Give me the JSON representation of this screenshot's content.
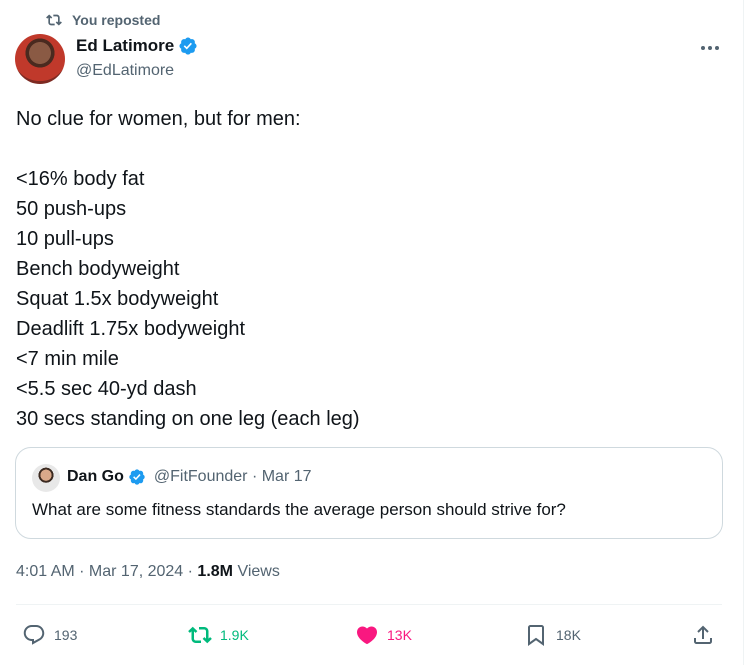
{
  "repost_label": "You reposted",
  "author": {
    "name": "Ed Latimore",
    "handle": "@EdLatimore"
  },
  "tweet_lines": [
    "No clue for women, but for men:",
    "",
    "<16% body fat",
    "50 push-ups",
    "10 pull-ups",
    "Bench bodyweight",
    "Squat 1.5x bodyweight",
    "Deadlift 1.75x bodyweight",
    "<7 min mile",
    "<5.5 sec 40-yd dash",
    "30 secs standing on one leg (each leg)"
  ],
  "quoted": {
    "name": "Dan Go",
    "handle_date": "@FitFounder · Mar 17",
    "text": "What are some fitness standards the average person should strive for?"
  },
  "meta": {
    "time_date": "4:01 AM · Mar 17, 2024 · ",
    "views_count": "1.8M",
    "views_label": " Views"
  },
  "actions": {
    "replies": "193",
    "reposts": "1.9K",
    "likes": "13K",
    "bookmarks": "18K"
  },
  "colors": {
    "accent": "#1d9bf0",
    "repost_green": "#00ba7c",
    "like_pink": "#f91880",
    "muted": "#536471"
  },
  "icons": [
    "repost-icon",
    "verified-badge-icon",
    "more-icon",
    "reply-icon",
    "retweet-icon",
    "heart-icon",
    "bookmark-icon",
    "share-icon"
  ]
}
